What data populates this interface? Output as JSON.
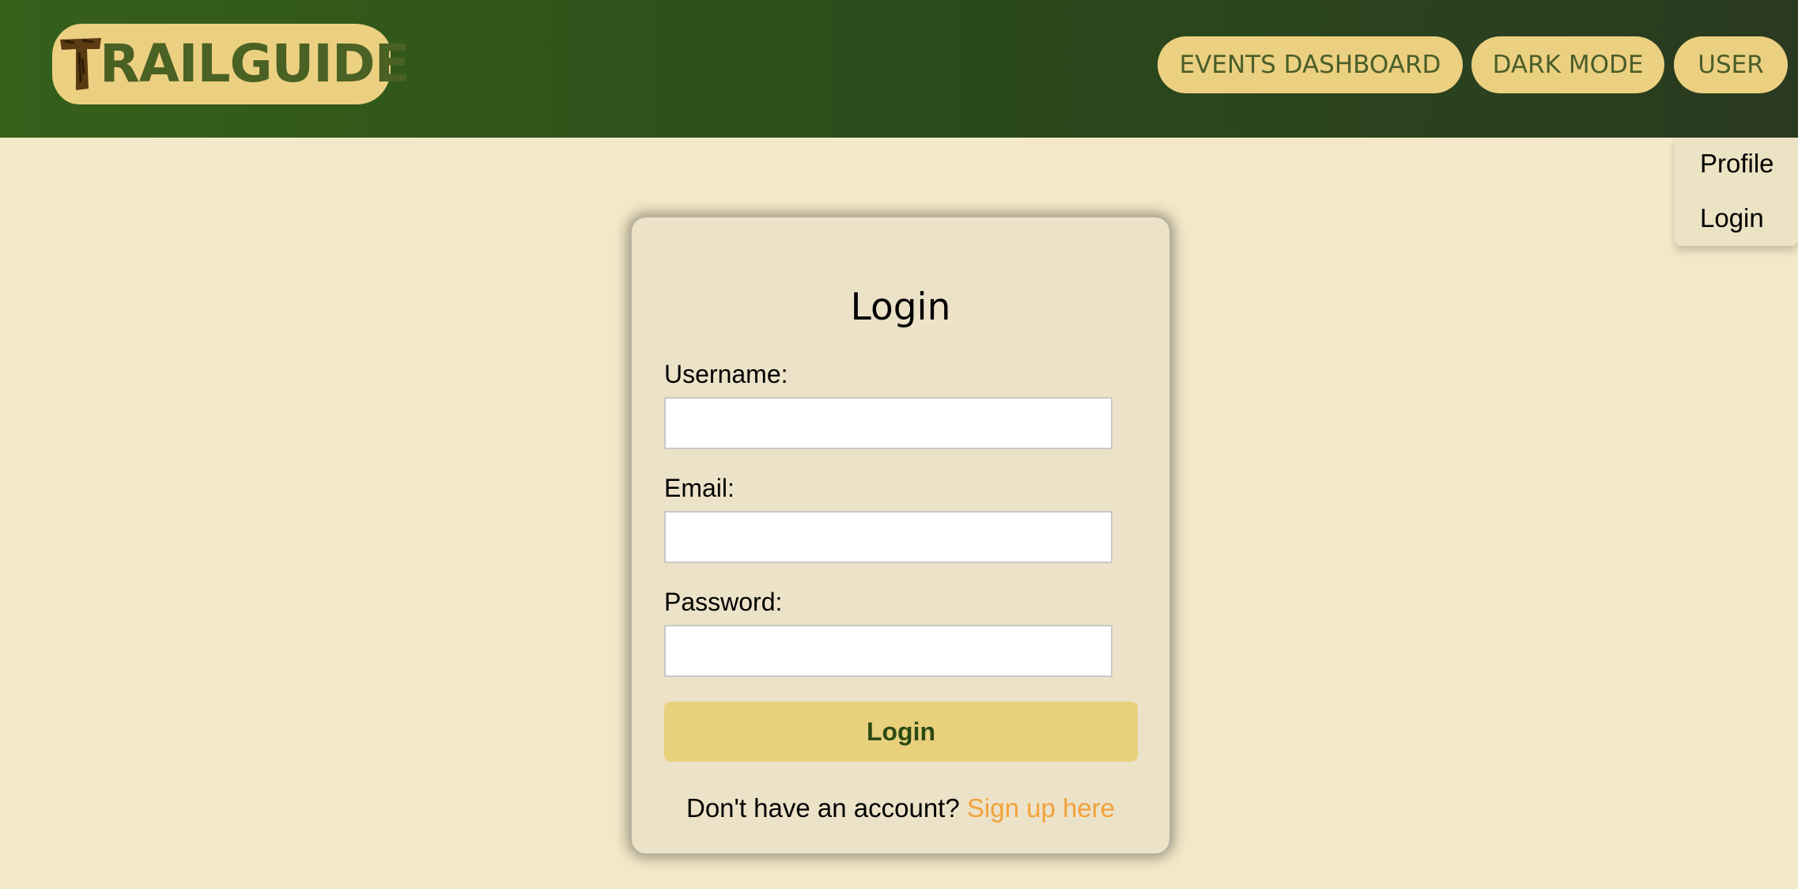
{
  "header": {
    "logo_text": "RAILGUIDE",
    "logo_initial": "T",
    "nav": {
      "events_label": "EVENTS DASHBOARD",
      "dark_mode_label": "DARK MODE",
      "user_label": "USER"
    }
  },
  "user_menu": {
    "items": [
      "Profile",
      "Login"
    ]
  },
  "login_form": {
    "title": "Login",
    "username_label": "Username:",
    "username_value": "",
    "email_label": "Email:",
    "email_value": "",
    "password_label": "Password:",
    "password_value": "",
    "submit_label": "Login",
    "signup_prompt": "Don't have an account?",
    "signup_link": "Sign up here"
  },
  "colors": {
    "header_green": "#35601a",
    "accent_yellow": "#ecd081",
    "background": "#f3e8c8",
    "link_orange": "#f2a23a"
  }
}
